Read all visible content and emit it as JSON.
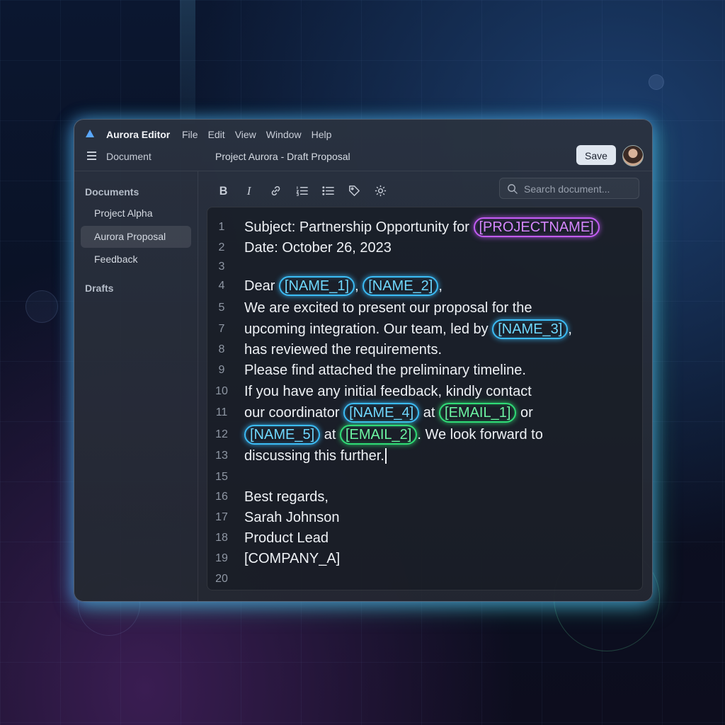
{
  "app": {
    "name": "Aurora Editor",
    "logo_icon": "aurora-triangle-icon"
  },
  "menu": [
    "File",
    "Edit",
    "View",
    "Window",
    "Help"
  ],
  "header": {
    "section_label": "Document",
    "doc_title": "Project Aurora - Draft Proposal",
    "save_label": "Save"
  },
  "sidebar": {
    "documents_heading": "Documents",
    "items": [
      {
        "label": "Project Alpha",
        "active": false
      },
      {
        "label": "Aurora Proposal",
        "active": true
      },
      {
        "label": "Feedback",
        "active": false
      }
    ],
    "drafts_heading": "Drafts"
  },
  "toolbar": {
    "tools": [
      "bold-icon",
      "italic-icon",
      "link-icon",
      "numbered-list-icon",
      "bulleted-list-icon",
      "tag-icon",
      "settings-gear-icon"
    ],
    "search_placeholder": "Search document..."
  },
  "editor": {
    "lines": [
      {
        "num": "1",
        "parts": [
          {
            "t": "Subject: Partnership Opportunity for "
          },
          {
            "t": "[PROJECTNAME]",
            "tag": "purple"
          }
        ]
      },
      {
        "num": "2",
        "parts": [
          {
            "t": "Date: October 26, 2023"
          }
        ]
      },
      {
        "num": "3",
        "parts": []
      },
      {
        "num": "4",
        "parts": [
          {
            "t": "Dear "
          },
          {
            "t": "[NAME_1]",
            "tag": "blue"
          },
          {
            "t": ", "
          },
          {
            "t": "[NAME_2]",
            "tag": "blue"
          },
          {
            "t": ","
          }
        ]
      },
      {
        "num": "5",
        "parts": [
          {
            "t": "We are excited to present our proposal for the"
          }
        ]
      },
      {
        "num": "7",
        "parts": [
          {
            "t": "upcoming integration.  Our team, led by "
          },
          {
            "t": "[NAME_3]",
            "tag": "blue"
          },
          {
            "t": ","
          }
        ]
      },
      {
        "num": "8",
        "parts": [
          {
            "t": "has reviewed the requirements."
          }
        ]
      },
      {
        "num": "9",
        "parts": [
          {
            "t": "Please find attached the preliminary timeline."
          }
        ]
      },
      {
        "num": "10",
        "parts": [
          {
            "t": "If you have any initial feedback, kindly contact"
          }
        ]
      },
      {
        "num": "11",
        "parts": [
          {
            "t": "our coordinator "
          },
          {
            "t": "[NAME_4]",
            "tag": "blue"
          },
          {
            "t": " at "
          },
          {
            "t": "[EMAIL_1]",
            "tag": "green"
          },
          {
            "t": " or"
          }
        ]
      },
      {
        "num": "12",
        "parts": [
          {
            "t": "[NAME_5]",
            "tag": "blue"
          },
          {
            "t": " at "
          },
          {
            "t": "[EMAIL_2]",
            "tag": "green"
          },
          {
            "t": ". We look forward to"
          }
        ]
      },
      {
        "num": "13",
        "parts": [
          {
            "t": "discussing this further."
          }
        ],
        "caret": true
      },
      {
        "num": "15",
        "parts": []
      },
      {
        "num": "16",
        "parts": [
          {
            "t": "Best regards,"
          }
        ]
      },
      {
        "num": "17",
        "parts": [
          {
            "t": "Sarah Johnson"
          }
        ]
      },
      {
        "num": "18",
        "parts": [
          {
            "t": "Product Lead"
          }
        ]
      },
      {
        "num": "19",
        "parts": [
          {
            "t": "[COMPANY_A]"
          }
        ]
      },
      {
        "num": "20",
        "parts": []
      }
    ]
  },
  "colors": {
    "tag_purple": "#c45cf5",
    "tag_blue": "#3bbcf5",
    "tag_green": "#2fdc76"
  }
}
